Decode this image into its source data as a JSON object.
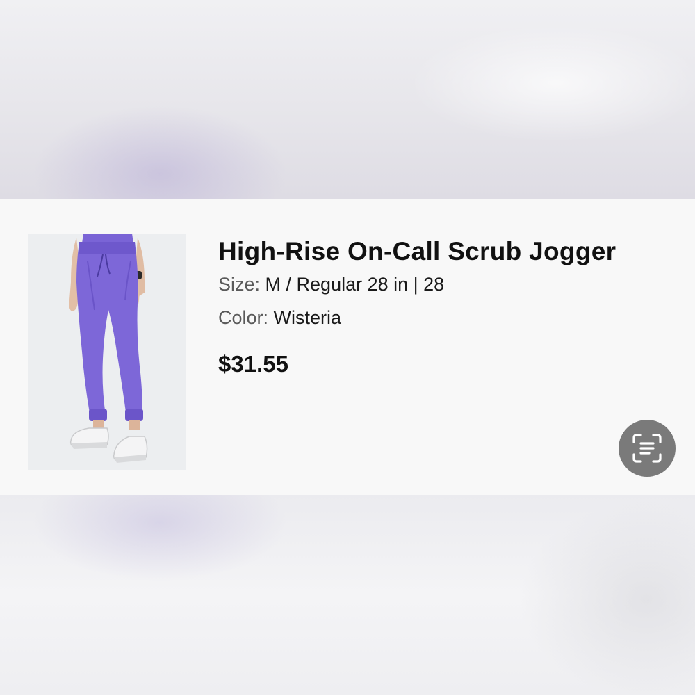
{
  "product": {
    "title": "High-Rise On-Call Scrub Jogger",
    "size_label": "Size:",
    "size_value": "M / Regular 28 in | 28",
    "color_label": "Color:",
    "color_value": "Wisteria",
    "price": "$31.55",
    "image_icon": "product-photo-purple-jogger",
    "product_color_hex": "#7d67d8"
  },
  "actions": {
    "scan_icon": "text-scan-icon"
  }
}
